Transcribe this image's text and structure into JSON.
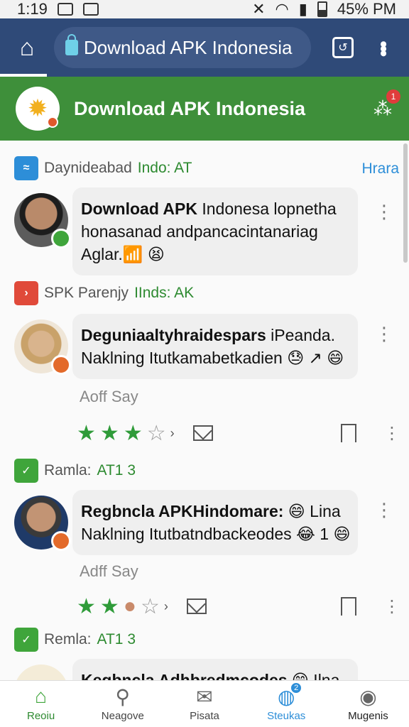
{
  "status_bar": {
    "time": "1:19",
    "battery": "45% PM"
  },
  "browser": {
    "url_title": "Download APK Indonesia"
  },
  "app_header": {
    "title": "Download APK Indonesia",
    "share_badge": "1"
  },
  "groups": [
    {
      "title": "Daynideabad",
      "accent": "Indo: AT",
      "right_link": "Hrara"
    },
    {
      "title": "SPK Parenjy",
      "accent": "IInds: AK"
    },
    {
      "title": "Ramla:",
      "accent": "AT1 3"
    },
    {
      "title": "Remla:",
      "accent": "AT1 3"
    }
  ],
  "posts": [
    {
      "bold": "Download APK",
      "text": " Indonesa lopnetha honasanad andpancacintanariag Aglar.📶 😫"
    },
    {
      "bold": "Deguniaaltyhraidespars",
      "text": " iPeanda. Naklning Itutkamabetkadien 😓 ↗ 😄",
      "meta": "Aoff Say"
    },
    {
      "bold": "Regbncla APKHindomare:",
      "text": " 😄 Lina Naklning Itutbatndbackeodes 😂 1 😄",
      "meta": "Adff Say"
    },
    {
      "bold": "Kegbncla Adhbredmcodes",
      "text": " 😄 Ilna"
    }
  ],
  "bottom_nav": [
    {
      "label": "Reoiu",
      "icon": "home-icon"
    },
    {
      "label": "Neagove",
      "icon": "search-icon"
    },
    {
      "label": "Pisata",
      "icon": "mail-icon"
    },
    {
      "label": "Steukas",
      "icon": "chat-icon",
      "badge": "2"
    },
    {
      "label": "Mugenis",
      "icon": "profile-icon"
    }
  ],
  "colors": {
    "header_green": "#3e8f3a",
    "browser_blue": "#2f4a78",
    "accent_blue": "#2d8ed8"
  }
}
